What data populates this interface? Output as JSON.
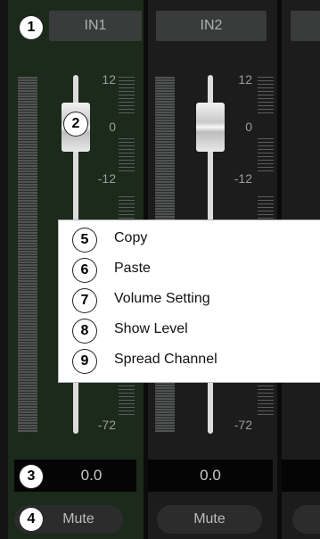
{
  "channels": [
    {
      "name": "IN1",
      "scale": [
        "12",
        "0",
        "-12",
        "-72"
      ],
      "value": "0.0",
      "mute": "Mute"
    },
    {
      "name": "IN2",
      "scale": [
        "12",
        "0",
        "-12",
        "-72"
      ],
      "value": "0.0",
      "mute": "Mute"
    }
  ],
  "callouts": {
    "c1": "1",
    "c2": "2",
    "c3": "3",
    "c4": "4"
  },
  "context_menu": {
    "items": [
      {
        "num": "5",
        "label": "Copy"
      },
      {
        "num": "6",
        "label": "Paste"
      },
      {
        "num": "7",
        "label": "Volume Setting"
      },
      {
        "num": "8",
        "label": "Show Level"
      },
      {
        "num": "9",
        "label": "Spread Channel"
      }
    ]
  },
  "colors": {
    "selected_strip": "#1b2a1b",
    "strip": "#1b1c1b",
    "menu_bg": "#ffffff"
  }
}
